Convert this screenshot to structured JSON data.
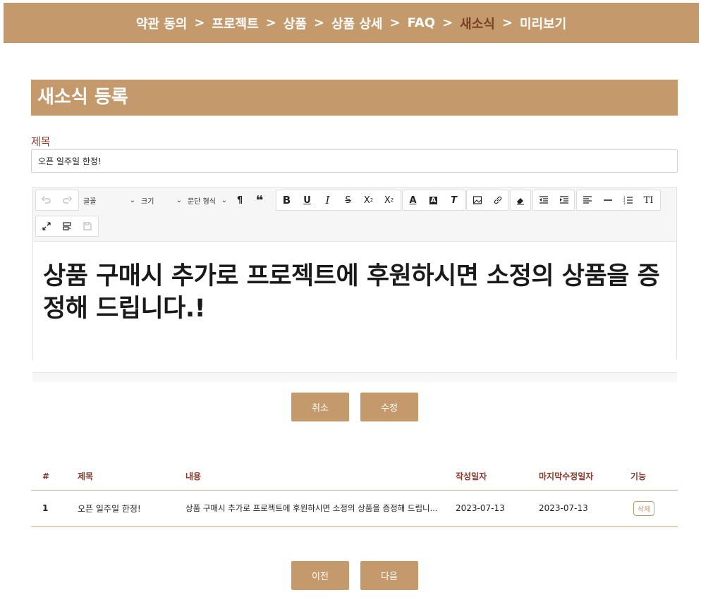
{
  "breadcrumb": [
    {
      "label": "약관 동의",
      "active": false
    },
    {
      "label": "프로젝트",
      "active": false
    },
    {
      "label": "상품",
      "active": false
    },
    {
      "label": "상품 상세",
      "active": false
    },
    {
      "label": "FAQ",
      "active": false
    },
    {
      "label": "새소식",
      "active": true
    },
    {
      "label": "미리보기",
      "active": false
    }
  ],
  "breadcrumb_sep": ">",
  "section_title": "새소식 등록",
  "form": {
    "title_label": "제목",
    "title_value": "오픈 일주일 한정!"
  },
  "toolbar": {
    "font_select": "글꼴",
    "size_select": "크기",
    "format_select": "문단 형식",
    "icons": [
      "undo-icon",
      "redo-icon",
      "paragraph-icon",
      "blockquote-icon",
      "bold-icon",
      "underline-icon",
      "italic-icon",
      "strikethrough-icon",
      "subscript-icon",
      "superscript-icon",
      "font-color-icon",
      "highlight-color-icon",
      "remove-format-icon",
      "image-icon",
      "link-icon",
      "eraser-icon",
      "outdent-icon",
      "indent-icon",
      "align-icon",
      "horizontal-rule-icon",
      "list-icon",
      "line-height-icon",
      "fullscreen-icon",
      "show-blocks-icon",
      "save-icon"
    ]
  },
  "editor_content": "상품 구매시 추가로 프로젝트에 후원하시면 소정의 상품을 증정해 드립니다.!",
  "buttons": {
    "cancel": "취소",
    "edit": "수정",
    "prev": "이전",
    "next": "다음"
  },
  "table": {
    "headers": [
      "#",
      "제목",
      "내용",
      "작성일자",
      "마지막수정일자",
      "기능"
    ],
    "rows": [
      {
        "num": "1",
        "title": "오픈 일주일 한정!",
        "content": "상품 구매시 추가로 프로젝트에 후원하시면 소정의 상품을 증정해 드립니...",
        "created": "2023-07-13",
        "modified": "2023-07-13",
        "action": "삭제"
      }
    ]
  },
  "colors": {
    "accent": "#c49a6c",
    "active_crumb": "#7a3e24",
    "label": "#8a3a2a"
  }
}
